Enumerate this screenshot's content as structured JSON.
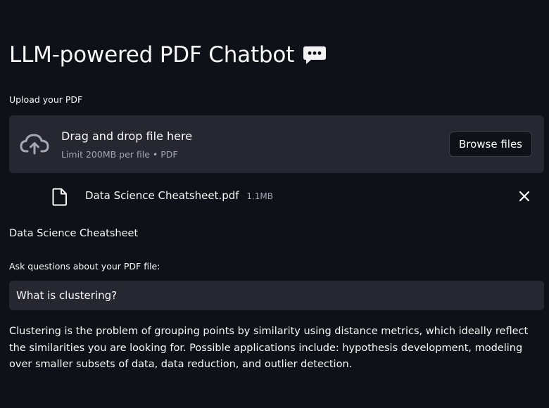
{
  "title": "LLM-powered PDF Chatbot",
  "title_icon": "speech-bubble-icon",
  "uploader": {
    "label": "Upload your PDF",
    "dropzone_text": "Drag and drop file here",
    "limit_text": "Limit 200MB per file • PDF",
    "browse_label": "Browse files",
    "icon": "cloud-upload-icon"
  },
  "uploaded_file": {
    "name": "Data Science Cheatsheet.pdf",
    "size": "1.1MB",
    "icon": "file-icon",
    "remove_icon": "close-icon"
  },
  "document_title": "Data Science Cheatsheet",
  "question": {
    "label": "Ask questions about your PDF file:",
    "value": "What is clustering?"
  },
  "answer": "Clustering is the problem of grouping points by similarity using distance metrics, which ideally reflect the similarities you are looking for. Possible applications include: hypothesis development, modeling over smaller subsets of data, data reduction, and outlier detection.",
  "colors": {
    "background": "#0e1117",
    "panel": "#262730",
    "text": "#fafafa",
    "muted": "#a3a8b4"
  }
}
